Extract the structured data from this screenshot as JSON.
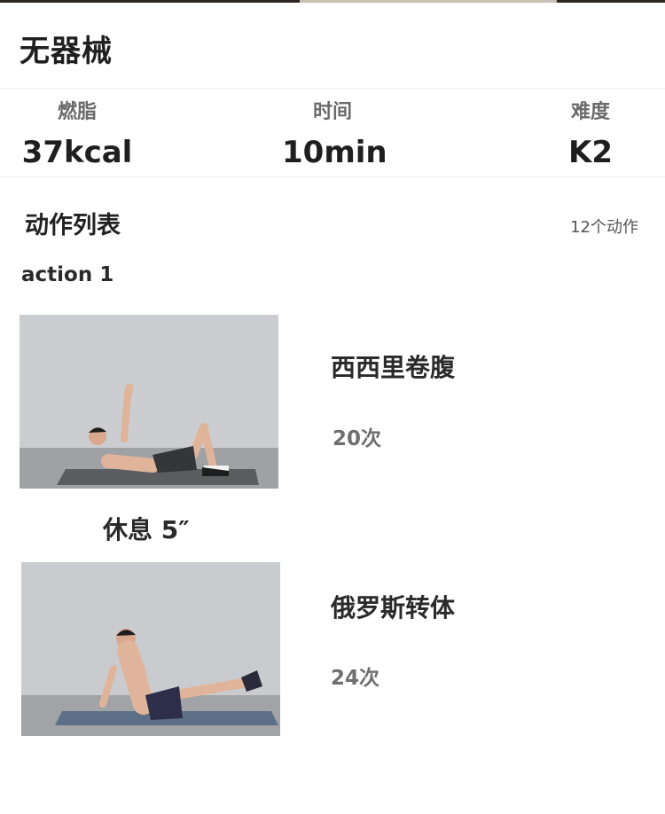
{
  "header": {
    "title": "无器械"
  },
  "stats": [
    {
      "label": "燃脂",
      "value": "37kcal"
    },
    {
      "label": "时间",
      "value": "10min"
    },
    {
      "label": "难度",
      "value": "K2"
    }
  ],
  "section": {
    "title": "动作列表",
    "count": "12个动作"
  },
  "group": {
    "title": "action 1"
  },
  "actions": [
    {
      "name": "西西里卷腹",
      "reps": "20次"
    },
    {
      "name": "俄罗斯转体",
      "reps": "24次"
    }
  ],
  "rest": {
    "text": "休息 5″"
  }
}
